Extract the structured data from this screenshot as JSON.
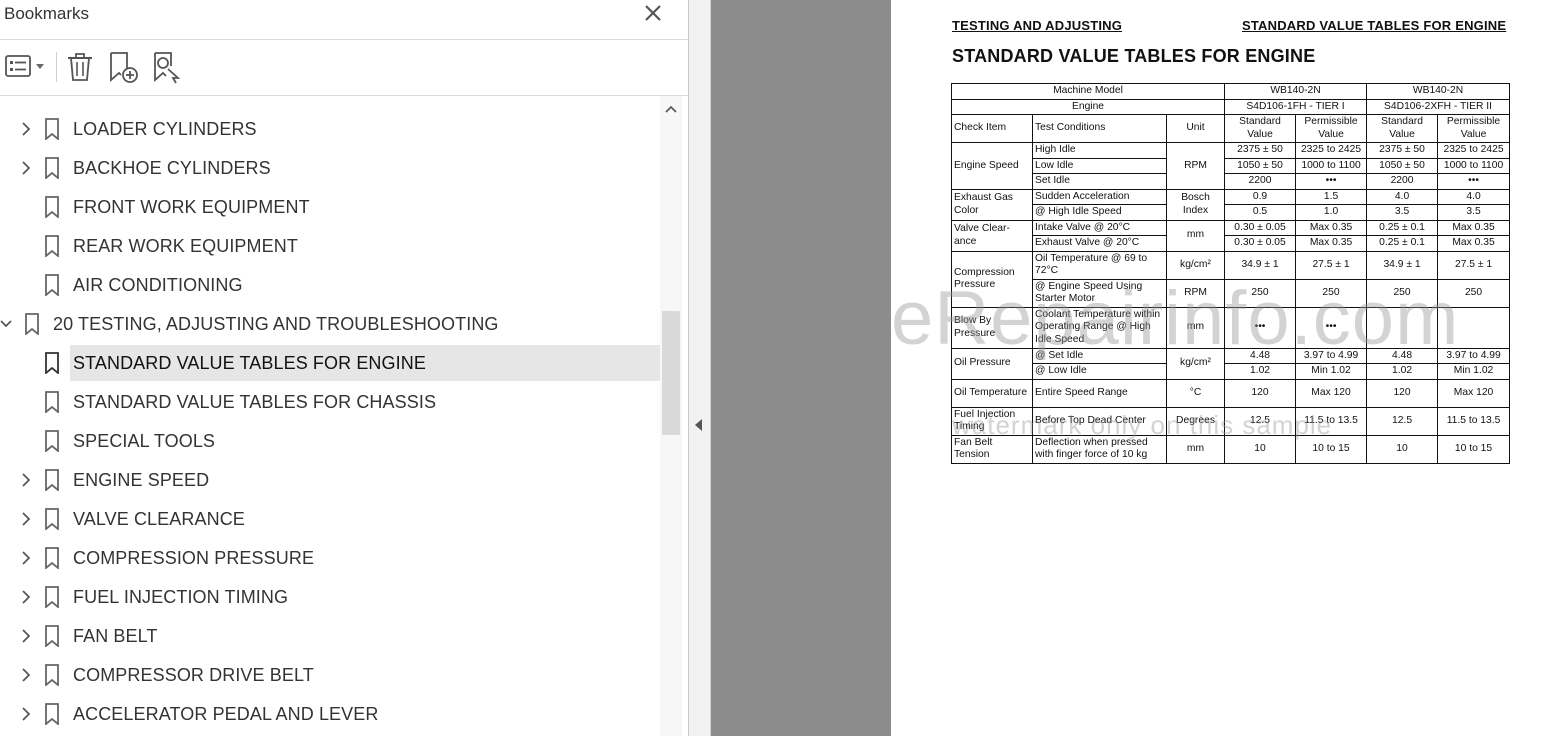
{
  "bookmarks_panel": {
    "title": "Bookmarks",
    "close_icon": "close-icon",
    "toolbar": {
      "options_icon": "list-options-icon",
      "delete_icon": "trash-icon",
      "new_bookmark_icon": "new-bookmark-icon",
      "find_bookmark_icon": "find-bookmark-icon"
    },
    "items": [
      {
        "label": "LOADER CYLINDERS",
        "expandable": true,
        "level": 1,
        "selected": false
      },
      {
        "label": "BACKHOE CYLINDERS",
        "expandable": true,
        "level": 1,
        "selected": false
      },
      {
        "label": "FRONT WORK EQUIPMENT",
        "expandable": false,
        "level": 1,
        "selected": false
      },
      {
        "label": "REAR WORK EQUIPMENT",
        "expandable": false,
        "level": 1,
        "selected": false
      },
      {
        "label": "AIR CONDITIONING",
        "expandable": false,
        "level": 1,
        "selected": false
      },
      {
        "label": "20 TESTING, ADJUSTING AND TROUBLESHOOTING",
        "expandable": true,
        "expanded": true,
        "level": 0,
        "selected": false
      },
      {
        "label": "STANDARD VALUE TABLES FOR ENGINE",
        "expandable": false,
        "level": 1,
        "selected": true
      },
      {
        "label": "STANDARD VALUE TABLES FOR CHASSIS",
        "expandable": false,
        "level": 1,
        "selected": false
      },
      {
        "label": "SPECIAL TOOLS",
        "expandable": false,
        "level": 1,
        "selected": false
      },
      {
        "label": "ENGINE SPEED",
        "expandable": true,
        "level": 1,
        "selected": false
      },
      {
        "label": "VALVE CLEARANCE",
        "expandable": true,
        "level": 1,
        "selected": false
      },
      {
        "label": "COMPRESSION PRESSURE",
        "expandable": true,
        "level": 1,
        "selected": false
      },
      {
        "label": "FUEL INJECTION TIMING",
        "expandable": true,
        "level": 1,
        "selected": false
      },
      {
        "label": "FAN BELT",
        "expandable": true,
        "level": 1,
        "selected": false
      },
      {
        "label": "COMPRESSOR DRIVE BELT",
        "expandable": true,
        "level": 1,
        "selected": false
      },
      {
        "label": "ACCELERATOR PEDAL AND LEVER",
        "expandable": true,
        "level": 1,
        "selected": false
      }
    ]
  },
  "document": {
    "header_left": "TESTING AND ADJUSTING",
    "header_right": "STANDARD VALUE TABLES FOR ENGINE",
    "title": "STANDARD VALUE TABLES FOR ENGINE",
    "table": {
      "machine_model_label": "Machine Model",
      "engine_label": "Engine",
      "model_1": "WB140-2N",
      "model_2": "WB140-2N",
      "engine_1": "S4D106-1FH - TIER I",
      "engine_2": "S4D106-2XFH - TIER II",
      "col_check_item": "Check Item",
      "col_test_conditions": "Test Conditions",
      "col_unit": "Unit",
      "col_standard_value": "Standard Value",
      "col_permissible_value": "Permissible Value",
      "engine_speed": {
        "item": "Engine Speed",
        "unit": "RPM",
        "rows": [
          {
            "condition": "High Idle",
            "v1": "2375 ± 50",
            "v2": "2325 to 2425",
            "v3": "2375 ± 50",
            "v4": "2325 to 2425"
          },
          {
            "condition": "Low Idle",
            "v1": "1050 ± 50",
            "v2": "1000 to 1100",
            "v3": "1050 ± 50",
            "v4": "1000 to 1100"
          },
          {
            "condition": "Set Idle",
            "v1": "2200",
            "v2": "•••",
            "v3": "2200",
            "v4": "•••"
          }
        ]
      },
      "exhaust_gas": {
        "item": "Exhaust Gas Color",
        "unit": "Bosch Index",
        "rows": [
          {
            "condition": "Sudden Acceleration",
            "v1": "0.9",
            "v2": "1.5",
            "v3": "4.0",
            "v4": "4.0"
          },
          {
            "condition": "@ High Idle Speed",
            "v1": "0.5",
            "v2": "1.0",
            "v3": "3.5",
            "v4": "3.5"
          }
        ]
      },
      "valve_clearance": {
        "item": "Valve Clear-ance",
        "unit": "mm",
        "rows": [
          {
            "condition": "Intake Valve @ 20°C",
            "v1": "0.30 ± 0.05",
            "v2": "Max 0.35",
            "v3": "0.25 ± 0.1",
            "v4": "Max 0.35"
          },
          {
            "condition": "Exhaust Valve @ 20°C",
            "v1": "0.30 ± 0.05",
            "v2": "Max 0.35",
            "v3": "0.25 ± 0.1",
            "v4": "Max 0.35"
          }
        ]
      },
      "compression": {
        "item": "Compression Pressure",
        "rows": [
          {
            "condition": "Oil Temperature @ 69 to 72°C",
            "unit": "kg/cm²",
            "v1": "34.9 ± 1",
            "v2": "27.5 ± 1",
            "v3": "34.9 ± 1",
            "v4": "27.5 ± 1"
          },
          {
            "condition": "@ Engine Speed Using Starter Motor",
            "unit": "RPM",
            "v1": "250",
            "v2": "250",
            "v3": "250",
            "v4": "250"
          }
        ]
      },
      "blow_by": {
        "item": "Blow By Pressure",
        "condition": "Coolant Temperature within Operating Range @ High Idle Speed",
        "unit": "mm",
        "v1": "•••",
        "v2": "•••",
        "v3": "",
        "v4": ""
      },
      "oil_pressure": {
        "item": "Oil Pressure",
        "unit": "kg/cm²",
        "rows": [
          {
            "condition": "@ Set Idle",
            "v1": "4.48",
            "v2": "3.97 to 4.99",
            "v3": "4.48",
            "v4": "3.97 to 4.99"
          },
          {
            "condition": "@ Low Idle",
            "v1": "1.02",
            "v2": "Min 1.02",
            "v3": "1.02",
            "v4": "Min 1.02"
          }
        ]
      },
      "oil_temp": {
        "item": "Oil Temperature",
        "condition": "Entire Speed Range",
        "unit": "°C",
        "v1": "120",
        "v2": "Max 120",
        "v3": "120",
        "v4": "Max 120"
      },
      "fuel_injection": {
        "item": "Fuel Injection Timing",
        "condition": "Before Top Dead Center",
        "unit": "Degrees",
        "v1": "12.5",
        "v2": "11.5 to 13.5",
        "v3": "12.5",
        "v4": "11.5 to 13.5"
      },
      "fan_belt": {
        "item": "Fan Belt Tension",
        "condition": "Deflection when pressed with finger force of 10 kg",
        "unit": "mm",
        "v1": "10",
        "v2": "10 to 15",
        "v3": "10",
        "v4": "10 to 15"
      }
    },
    "watermark": "eRepairinfo.com",
    "watermark_note": "watermark only on this sample"
  },
  "colors": {
    "selected_row": "#e6e6e6",
    "page_background": "#8c8c8c",
    "icon": "#555555"
  }
}
